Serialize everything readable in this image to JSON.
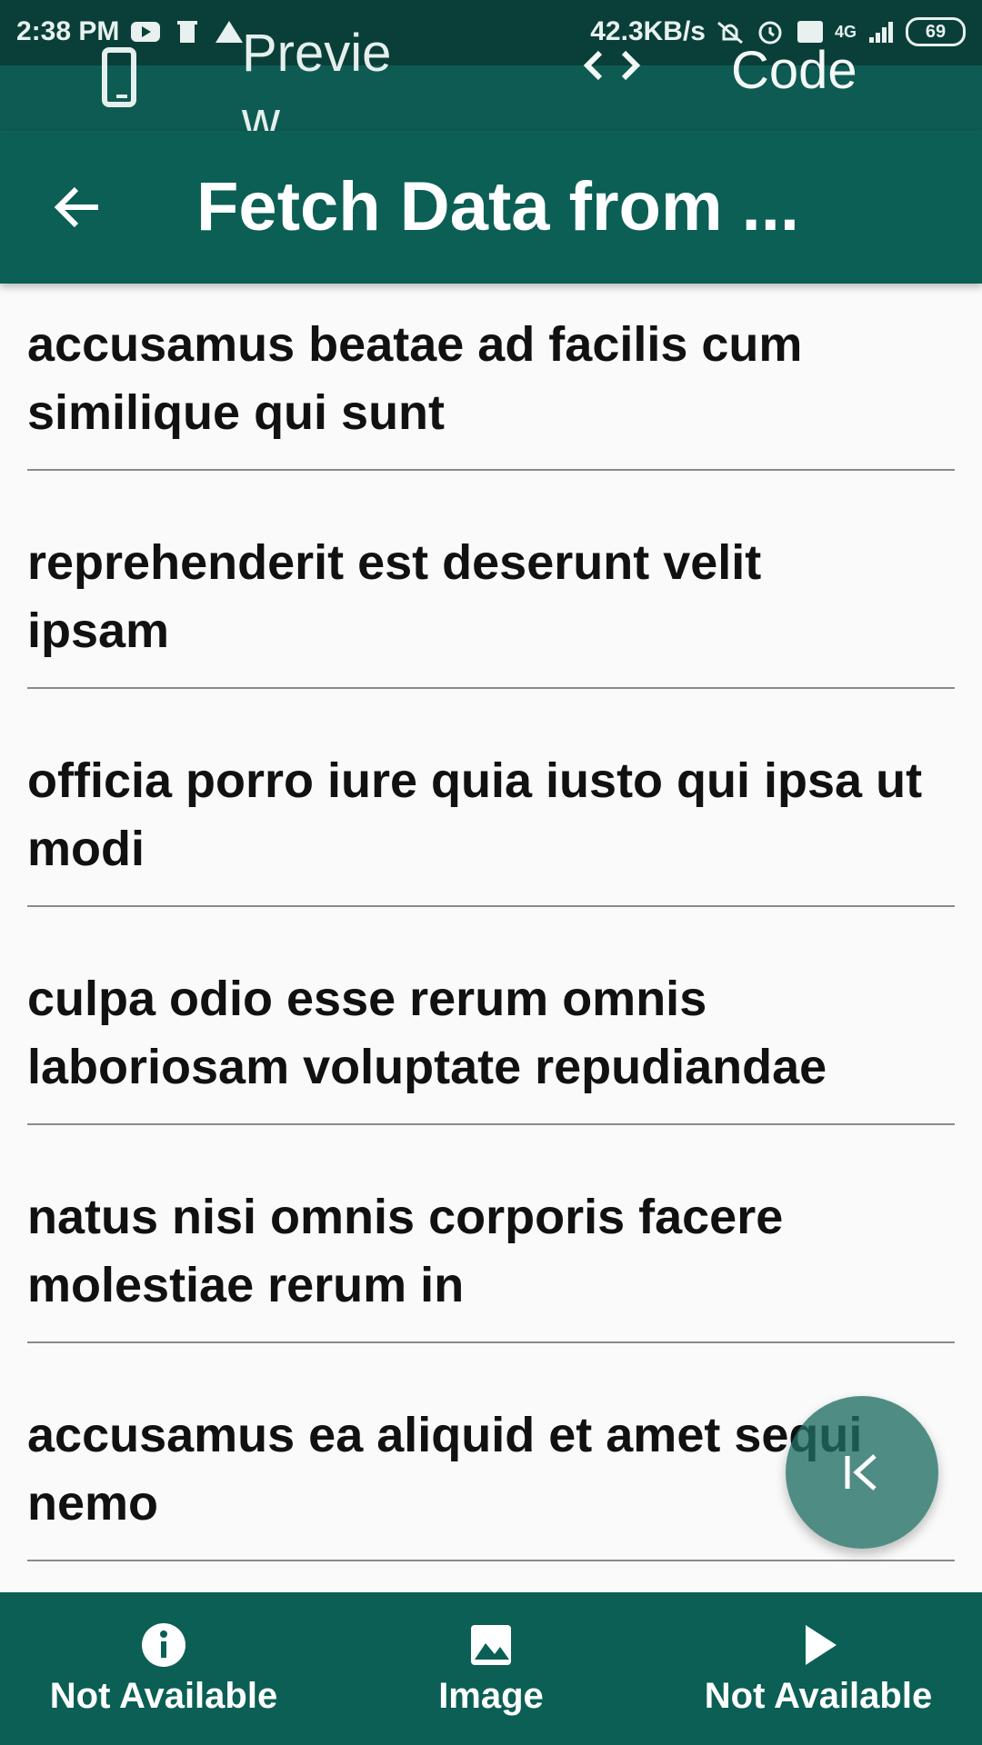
{
  "status_bar": {
    "time": "2:38 PM",
    "network_speed": "42.3KB/s",
    "network_type": "4G",
    "battery": "69",
    "icons": [
      "youtube-icon",
      "trash-icon",
      "warning-icon",
      "mute-icon",
      "alarm-icon",
      "volte-icon",
      "signal-icon",
      "battery-icon"
    ]
  },
  "top_bar": {
    "preview_label": "Preview",
    "code_label": "Code",
    "icons": [
      "phone-icon",
      "code-brackets-icon"
    ]
  },
  "app_bar": {
    "title": "Fetch Data from ...",
    "back_icon": "arrow-back-icon"
  },
  "list": {
    "items": [
      "accusamus beatae ad facilis cum similique qui sunt",
      "reprehenderit est deserunt velit ipsam",
      "officia porro iure quia iusto qui ipsa ut modi",
      "culpa odio esse rerum omnis laboriosam voluptate repudiandae",
      "natus nisi omnis corporis facere molestiae rerum in",
      "accusamus ea aliquid et amet sequi nemo"
    ]
  },
  "fab": {
    "icon": "collapse-left-icon"
  },
  "bottom_nav": {
    "items": [
      {
        "label": "Not Available",
        "icon": "info-icon"
      },
      {
        "label": "Image",
        "icon": "image-icon"
      },
      {
        "label": "Not Available",
        "icon": "play-icon"
      }
    ]
  },
  "colors": {
    "primary": "#0b5f55",
    "primary_dark": "#0a3f39",
    "top_bar": "#0d5b52",
    "background": "#fafafa",
    "fab": "#1f6e63"
  }
}
